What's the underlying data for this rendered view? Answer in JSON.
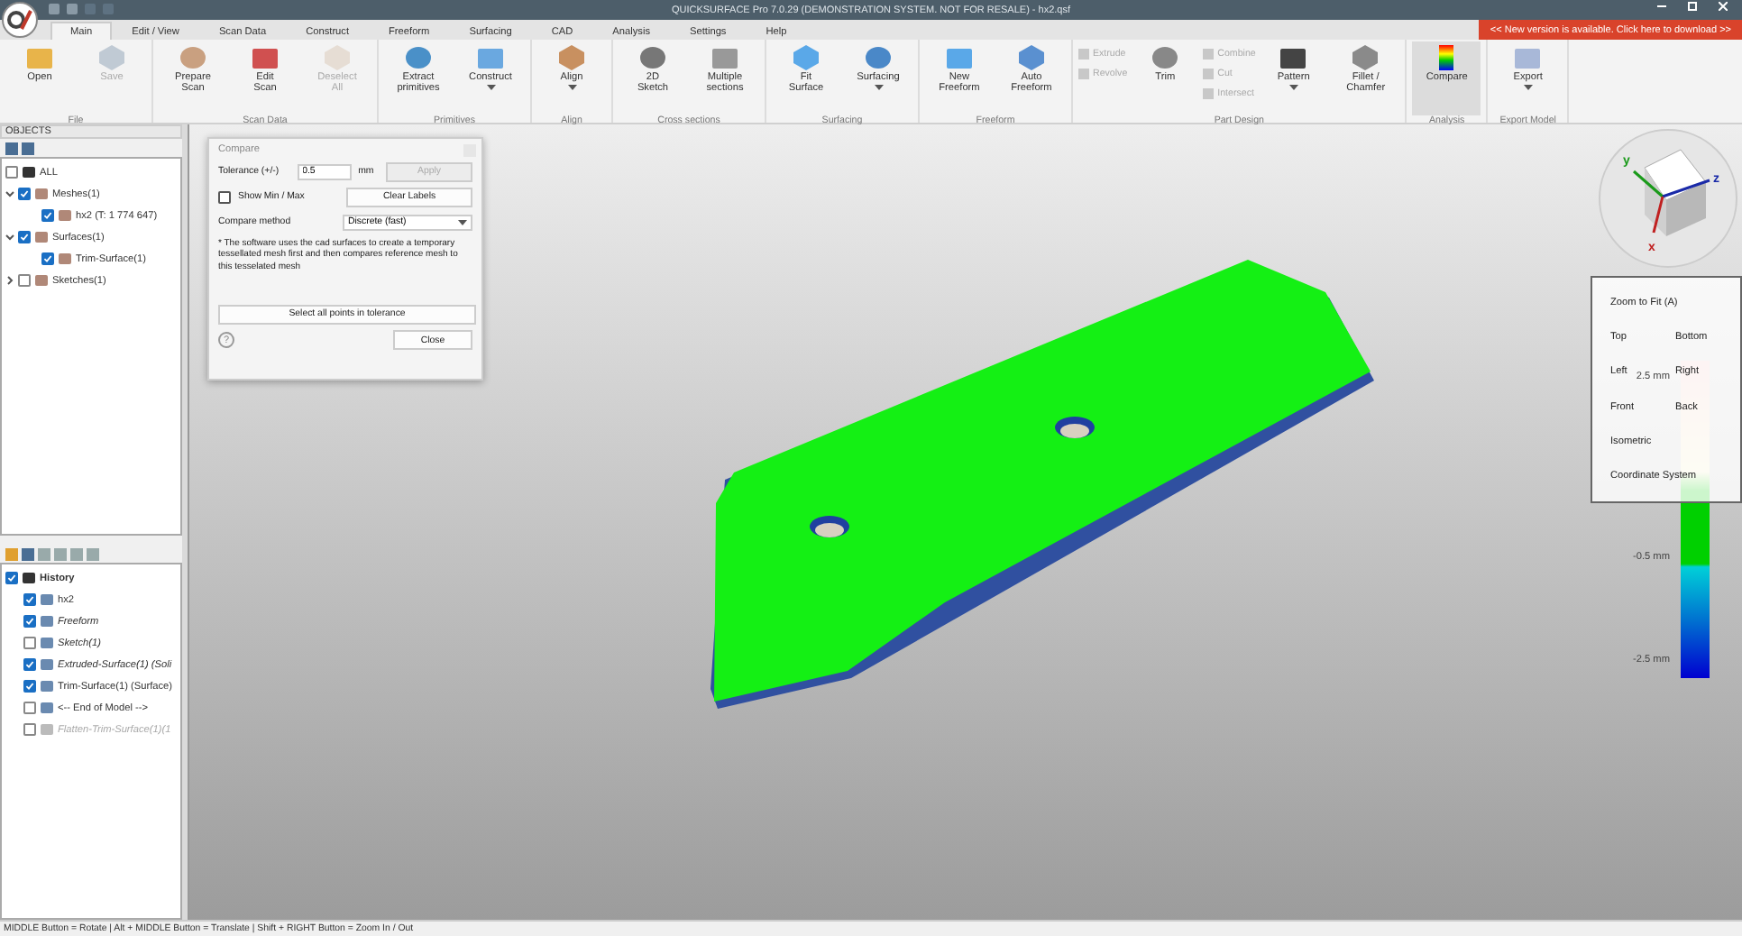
{
  "window": {
    "title": "QUICKSURFACE Pro 7.0.29 (DEMONSTRATION SYSTEM. NOT FOR RESALE) - hx2.qsf"
  },
  "tabs": [
    {
      "label": "Main",
      "selected": true
    },
    {
      "label": "Edit / View",
      "selected": false
    },
    {
      "label": "Scan Data",
      "selected": false
    },
    {
      "label": "Construct",
      "selected": false
    },
    {
      "label": "Freeform",
      "selected": false
    },
    {
      "label": "Surfacing",
      "selected": false
    },
    {
      "label": "CAD",
      "selected": false
    },
    {
      "label": "Analysis",
      "selected": false
    },
    {
      "label": "Settings",
      "selected": false
    },
    {
      "label": "Help",
      "selected": false
    }
  ],
  "update_banner": "<< New version is available. Click here to download >>",
  "ribbon": {
    "groups": [
      {
        "label": "File",
        "buttons": [
          {
            "kind": "large",
            "label": "Open",
            "disabled": false,
            "active": false,
            "dropdown": false
          },
          {
            "kind": "large",
            "label": "Save",
            "disabled": true,
            "active": false,
            "dropdown": false
          }
        ]
      },
      {
        "label": "Scan Data",
        "buttons": [
          {
            "kind": "large",
            "label": "Prepare\nScan",
            "disabled": false,
            "active": false,
            "dropdown": false
          },
          {
            "kind": "large",
            "label": "Edit\nScan",
            "disabled": false,
            "active": false,
            "dropdown": false
          },
          {
            "kind": "large",
            "label": "Deselect\nAll",
            "disabled": true,
            "active": false,
            "dropdown": false
          }
        ]
      },
      {
        "label": "Primitives",
        "buttons": [
          {
            "kind": "large",
            "label": "Extract\nprimitives",
            "disabled": false,
            "active": false,
            "dropdown": false
          },
          {
            "kind": "large",
            "label": "Construct",
            "disabled": false,
            "active": false,
            "dropdown": true
          }
        ]
      },
      {
        "label": "Align",
        "buttons": [
          {
            "kind": "large",
            "label": "Align",
            "disabled": false,
            "active": false,
            "dropdown": true
          }
        ]
      },
      {
        "label": "Cross sections",
        "buttons": [
          {
            "kind": "large",
            "label": "2D\nSketch",
            "disabled": false,
            "active": false,
            "dropdown": false
          },
          {
            "kind": "large",
            "label": "Multiple\nsections",
            "disabled": false,
            "active": false,
            "dropdown": false
          }
        ]
      },
      {
        "label": "Surfacing",
        "buttons": [
          {
            "kind": "large",
            "label": "Fit\nSurface",
            "disabled": false,
            "active": false,
            "dropdown": false
          },
          {
            "kind": "large",
            "label": "Surfacing",
            "disabled": false,
            "active": false,
            "dropdown": true
          }
        ]
      },
      {
        "label": "Freeform",
        "buttons": [
          {
            "kind": "large",
            "label": "New\nFreeform",
            "disabled": false,
            "active": false,
            "dropdown": false
          },
          {
            "kind": "large",
            "label": "Auto\nFreeform",
            "disabled": false,
            "active": false,
            "dropdown": false
          }
        ]
      },
      {
        "label": "Part Design",
        "buttons": [
          {
            "kind": "stack",
            "items": [
              {
                "label": "Extrude",
                "disabled": true
              },
              {
                "label": "Revolve",
                "disabled": true
              }
            ]
          },
          {
            "kind": "large",
            "label": "Trim",
            "disabled": false,
            "active": false,
            "dropdown": false
          },
          {
            "kind": "stack",
            "items": [
              {
                "label": "Combine",
                "disabled": true
              },
              {
                "label": "Cut",
                "disabled": true
              },
              {
                "label": "Intersect",
                "disabled": true
              }
            ]
          },
          {
            "kind": "large",
            "label": "Pattern",
            "disabled": false,
            "active": false,
            "dropdown": true
          },
          {
            "kind": "large",
            "label": "Fillet /\nChamfer",
            "disabled": false,
            "active": false,
            "dropdown": false
          }
        ]
      },
      {
        "label": "Analysis",
        "buttons": [
          {
            "kind": "large",
            "label": "Compare",
            "disabled": false,
            "active": true,
            "dropdown": false
          }
        ]
      },
      {
        "label": "Export Model",
        "buttons": [
          {
            "kind": "large",
            "label": "Export",
            "disabled": false,
            "active": false,
            "dropdown": true
          }
        ]
      }
    ]
  },
  "objects": {
    "title": "OBJECTS",
    "tree": [
      {
        "label": "ALL",
        "checked": false
      },
      {
        "label": "Meshes(1)",
        "checked": true,
        "expanded": true,
        "children": [
          {
            "label": "hx2 (T: 1 774 647)",
            "checked": true
          }
        ]
      },
      {
        "label": "Surfaces(1)",
        "checked": true,
        "expanded": true,
        "children": [
          {
            "label": "Trim-Surface(1)",
            "checked": true
          }
        ]
      },
      {
        "label": "Sketches(1)",
        "checked": false,
        "expanded": false
      }
    ]
  },
  "history": {
    "title": "History",
    "checked": true,
    "items": [
      {
        "label": "hx2",
        "checked": true,
        "italic": false,
        "disabled": false
      },
      {
        "label": "Freeform",
        "checked": true,
        "italic": true,
        "disabled": false
      },
      {
        "label": "Sketch(1)",
        "checked": false,
        "italic": true,
        "disabled": false
      },
      {
        "label": "Extruded-Surface(1) (Soli",
        "checked": true,
        "italic": true,
        "disabled": false
      },
      {
        "label": "Trim-Surface(1) (Surface)",
        "checked": true,
        "italic": false,
        "disabled": false
      },
      {
        "label": "<-- End of Model -->",
        "checked": false,
        "italic": false,
        "disabled": false
      },
      {
        "label": "Flatten-Trim-Surface(1)(1",
        "checked": false,
        "italic": true,
        "disabled": true
      }
    ]
  },
  "compare_dialog": {
    "title": "Compare",
    "tolerance_label": "Tolerance (+/-)",
    "tolerance_value": "0.5",
    "unit": "mm",
    "apply": {
      "label": "Apply",
      "disabled": true
    },
    "show_min_max": {
      "label": "Show Min / Max",
      "checked": false
    },
    "clear_labels": "Clear Labels",
    "method_label": "Compare method",
    "method_value": "Discrete (fast)",
    "note": "* The software uses the cad surfaces to create a temporary tessellated mesh first and then compares reference mesh to this tesselated mesh",
    "select_all": "Select all points in tolerance",
    "help": "?",
    "close": "Close"
  },
  "axes": {
    "x": "x",
    "y": "y",
    "z": "z"
  },
  "view_menu": [
    [
      "Zoom to Fit (A)"
    ],
    [
      "Top",
      "Bottom"
    ],
    [
      "Left",
      "Right"
    ],
    [
      "Front",
      "Back"
    ],
    [
      "Isometric"
    ],
    [
      "Coordinate System"
    ]
  ],
  "legend": {
    "labels": [
      "2.5 mm",
      "-0.5 mm",
      "-2.5 mm"
    ]
  },
  "status_bar": "MIDDLE Button = Rotate | Alt + MIDDLE Button = Translate | Shift + RIGHT Button = Zoom In / Out"
}
